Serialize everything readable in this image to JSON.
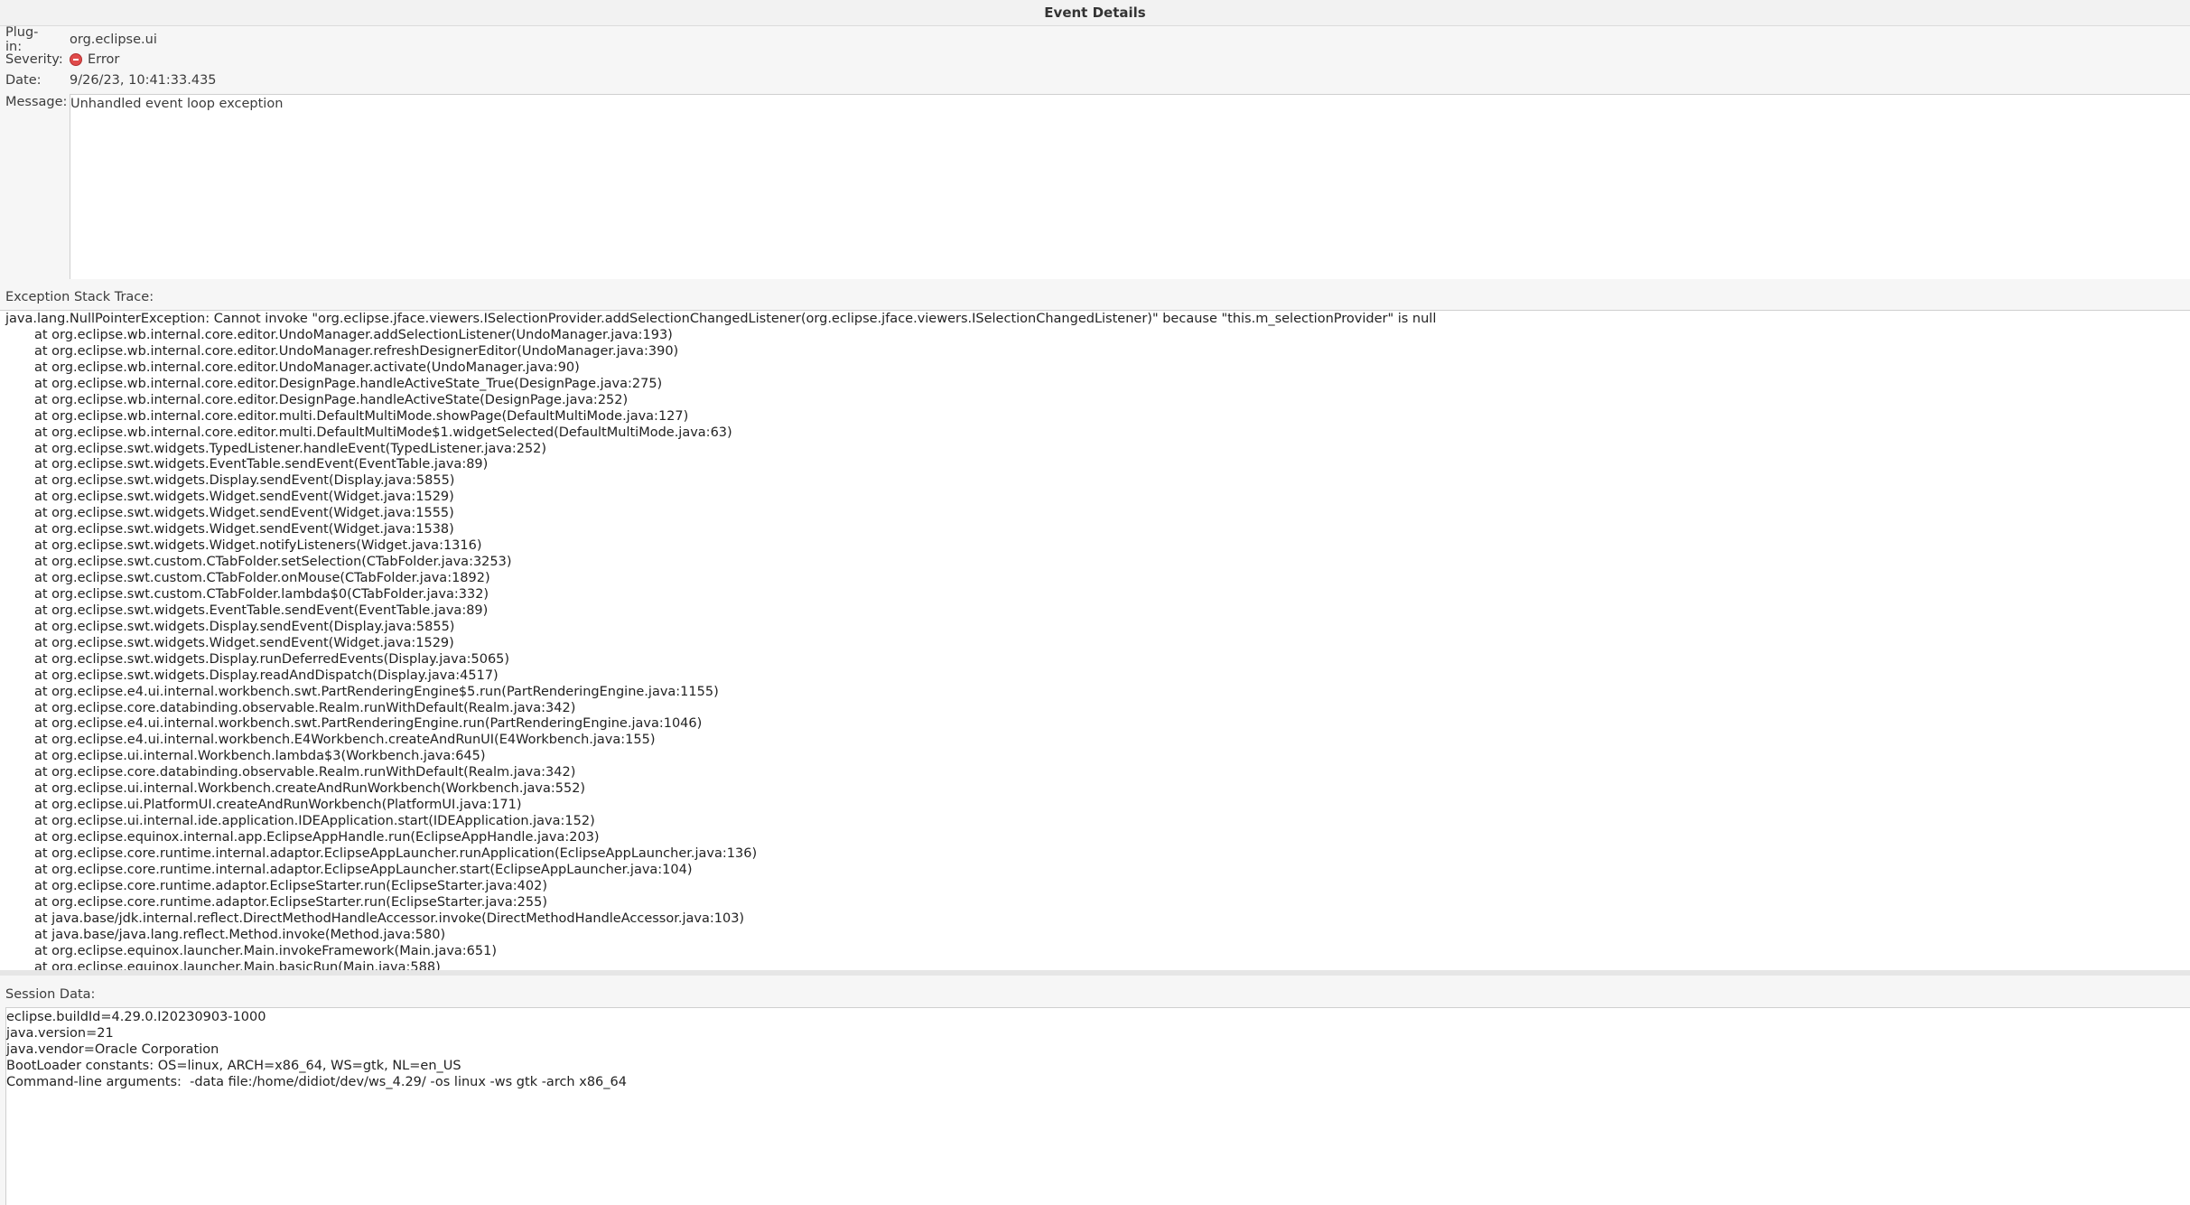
{
  "window": {
    "title": "Event Details"
  },
  "fields": {
    "plugin_label": "Plug-in:",
    "plugin_value": "org.eclipse.ui",
    "severity_label": "Severity:",
    "severity_icon": "error-icon",
    "severity_value": "Error",
    "date_label": "Date:",
    "date_value": "9/26/23, 10:41:33.435",
    "message_label": "Message:",
    "message_value": "Unhandled event loop exception"
  },
  "stack": {
    "label": "Exception Stack Trace:",
    "exception": "java.lang.NullPointerException: Cannot invoke \"org.eclipse.jface.viewers.ISelectionProvider.addSelectionChangedListener(org.eclipse.jface.viewers.ISelectionChangedListener)\" because \"this.m_selectionProvider\" is null",
    "frames": [
      "at org.eclipse.wb.internal.core.editor.UndoManager.addSelectionListener(UndoManager.java:193)",
      "at org.eclipse.wb.internal.core.editor.UndoManager.refreshDesignerEditor(UndoManager.java:390)",
      "at org.eclipse.wb.internal.core.editor.UndoManager.activate(UndoManager.java:90)",
      "at org.eclipse.wb.internal.core.editor.DesignPage.handleActiveState_True(DesignPage.java:275)",
      "at org.eclipse.wb.internal.core.editor.DesignPage.handleActiveState(DesignPage.java:252)",
      "at org.eclipse.wb.internal.core.editor.multi.DefaultMultiMode.showPage(DefaultMultiMode.java:127)",
      "at org.eclipse.wb.internal.core.editor.multi.DefaultMultiMode$1.widgetSelected(DefaultMultiMode.java:63)",
      "at org.eclipse.swt.widgets.TypedListener.handleEvent(TypedListener.java:252)",
      "at org.eclipse.swt.widgets.EventTable.sendEvent(EventTable.java:89)",
      "at org.eclipse.swt.widgets.Display.sendEvent(Display.java:5855)",
      "at org.eclipse.swt.widgets.Widget.sendEvent(Widget.java:1529)",
      "at org.eclipse.swt.widgets.Widget.sendEvent(Widget.java:1555)",
      "at org.eclipse.swt.widgets.Widget.sendEvent(Widget.java:1538)",
      "at org.eclipse.swt.widgets.Widget.notifyListeners(Widget.java:1316)",
      "at org.eclipse.swt.custom.CTabFolder.setSelection(CTabFolder.java:3253)",
      "at org.eclipse.swt.custom.CTabFolder.onMouse(CTabFolder.java:1892)",
      "at org.eclipse.swt.custom.CTabFolder.lambda$0(CTabFolder.java:332)",
      "at org.eclipse.swt.widgets.EventTable.sendEvent(EventTable.java:89)",
      "at org.eclipse.swt.widgets.Display.sendEvent(Display.java:5855)",
      "at org.eclipse.swt.widgets.Widget.sendEvent(Widget.java:1529)",
      "at org.eclipse.swt.widgets.Display.runDeferredEvents(Display.java:5065)",
      "at org.eclipse.swt.widgets.Display.readAndDispatch(Display.java:4517)",
      "at org.eclipse.e4.ui.internal.workbench.swt.PartRenderingEngine$5.run(PartRenderingEngine.java:1155)",
      "at org.eclipse.core.databinding.observable.Realm.runWithDefault(Realm.java:342)",
      "at org.eclipse.e4.ui.internal.workbench.swt.PartRenderingEngine.run(PartRenderingEngine.java:1046)",
      "at org.eclipse.e4.ui.internal.workbench.E4Workbench.createAndRunUI(E4Workbench.java:155)",
      "at org.eclipse.ui.internal.Workbench.lambda$3(Workbench.java:645)",
      "at org.eclipse.core.databinding.observable.Realm.runWithDefault(Realm.java:342)",
      "at org.eclipse.ui.internal.Workbench.createAndRunWorkbench(Workbench.java:552)",
      "at org.eclipse.ui.PlatformUI.createAndRunWorkbench(PlatformUI.java:171)",
      "at org.eclipse.ui.internal.ide.application.IDEApplication.start(IDEApplication.java:152)",
      "at org.eclipse.equinox.internal.app.EclipseAppHandle.run(EclipseAppHandle.java:203)",
      "at org.eclipse.core.runtime.internal.adaptor.EclipseAppLauncher.runApplication(EclipseAppLauncher.java:136)",
      "at org.eclipse.core.runtime.internal.adaptor.EclipseAppLauncher.start(EclipseAppLauncher.java:104)",
      "at org.eclipse.core.runtime.adaptor.EclipseStarter.run(EclipseStarter.java:402)",
      "at org.eclipse.core.runtime.adaptor.EclipseStarter.run(EclipseStarter.java:255)",
      "at java.base/jdk.internal.reflect.DirectMethodHandleAccessor.invoke(DirectMethodHandleAccessor.java:103)",
      "at java.base/java.lang.reflect.Method.invoke(Method.java:580)",
      "at org.eclipse.equinox.launcher.Main.invokeFramework(Main.java:651)",
      "at org.eclipse.equinox.launcher.Main.basicRun(Main.java:588)"
    ]
  },
  "session": {
    "label": "Session Data:",
    "lines": [
      "eclipse.buildId=4.29.0.I20230903-1000",
      "java.version=21",
      "java.vendor=Oracle Corporation",
      "BootLoader constants: OS=linux, ARCH=x86_64, WS=gtk, NL=en_US",
      "Command-line arguments:  -data file:/home/didiot/dev/ws_4.29/ -os linux -ws gtk -arch x86_64"
    ]
  }
}
